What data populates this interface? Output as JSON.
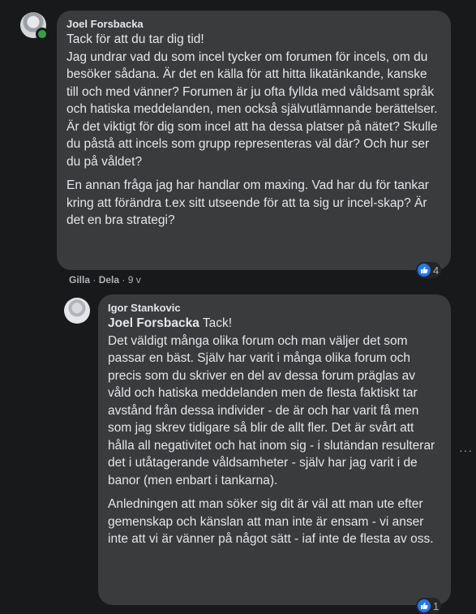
{
  "comment1": {
    "author": "Joel Forsbacka",
    "paragraph1": "Tack för att du tar dig tid!\nJag undrar vad du som incel tycker om forumen för incels, om du besöker sådana. Är det en källa för att hitta likatänkande, kanske till och med vänner? Forumen är ju ofta fyllda med våldsamt språk och hatiska meddelanden, men också självutlämnande berättelser. Är det viktigt för dig som incel att ha dessa platser på nätet? Skulle du påstå att incels som grupp representeras väl där? Och hur ser du på våldet?",
    "paragraph2": "En annan fråga jag har handlar om maxing. Vad har du för tankar kring att förändra t.ex sitt utseende för att ta sig ur incel-skap? Är det en bra strategi?",
    "like_label": "Gilla",
    "separator": "·",
    "share_label": "Dela",
    "time": "9 v",
    "reaction_count": "4"
  },
  "reply1": {
    "author": "Igor Stankovic",
    "mention": "Joel Forsbacka",
    "paragraph1_after_mention": " Tack!\nDet väldigt många olika forum och man väljer det som passar en bäst. Själv har varit i många olika forum och precis som du skriver en del av dessa forum präglas av våld och hatiska meddelanden men de flesta faktiskt tar avstånd från dessa individer - de är och har varit få men som jag skrev tidigare så blir de allt fler. Det är svårt att hålla all negativitet och hat inom sig - i slutändan resulterar det i utåtagerande våldsamheter - själv har jag varit i de banor (men enbart i tankarna).",
    "paragraph2": "Anledningen att man söker sig dit är väl att man ute efter gemenskap och känslan att man inte är ensam - vi anser inte att vi är vänner på något sätt - iaf inte de flesta av oss.",
    "reaction_count": "1"
  },
  "more_options": "···",
  "colors": {
    "background": "#18191a",
    "bubble": "#3a3b3c",
    "text": "#e4e6eb",
    "muted": "#b0b3b8",
    "like_blue": "#2078f4",
    "online_green": "#31a24c"
  },
  "icons": [
    "avatar-joel",
    "online-indicator",
    "avatar-igor",
    "like-reaction-icon",
    "more-options-icon"
  ]
}
